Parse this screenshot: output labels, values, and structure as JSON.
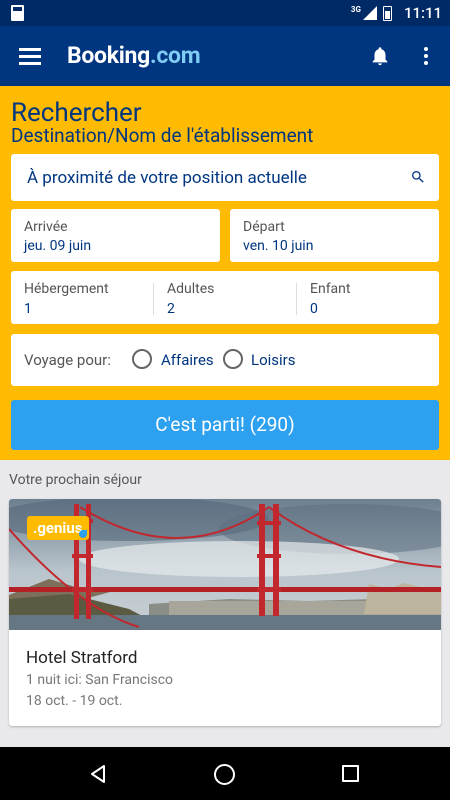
{
  "status_bar": {
    "network": "3G",
    "time": "11:11",
    "icons": [
      "sd-card-icon",
      "signal-icon",
      "battery-icon"
    ]
  },
  "app_bar": {
    "logo_main": "Booking",
    "logo_suffix": ".com",
    "icons": [
      "menu-icon",
      "bell-icon",
      "more-vert-icon"
    ]
  },
  "search": {
    "title": "Rechercher",
    "destination_label": "Destination/Nom de l'établissement",
    "destination_value": "À proximité de votre position actuelle",
    "checkin": {
      "label": "Arrivée",
      "value": "jeu. 09 juin"
    },
    "checkout": {
      "label": "Départ",
      "value": "ven. 10 juin"
    },
    "rooms": {
      "label": "Hébergement",
      "value": "1"
    },
    "adults": {
      "label": "Adultes",
      "value": "2"
    },
    "children": {
      "label": "Enfant",
      "value": "0"
    },
    "trip_purpose": {
      "label": "Voyage pour:",
      "options": [
        "Affaires",
        "Loisirs"
      ]
    },
    "submit_label": "C'est parti! (290)"
  },
  "next_stay": {
    "section_label": "Votre prochain séjour",
    "badge": ".genius",
    "hotel_name": "Hotel Stratford",
    "nights": "1 nuit ici: San Francisco",
    "dates": "18 oct. - 19 oct."
  },
  "colors": {
    "brand_blue": "#003580",
    "brand_yellow": "#febb02",
    "button_blue": "#2da0ef",
    "logo_accent": "#7fcdf5"
  }
}
